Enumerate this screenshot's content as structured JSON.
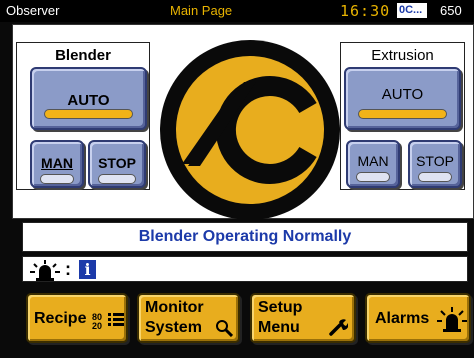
{
  "topbar": {
    "user": "Observer",
    "page_title": "Main Page",
    "clock": "16:30",
    "code": "0C...",
    "number": "650"
  },
  "blender": {
    "title": "Blender",
    "auto_label": "AUTO",
    "man_label": "MAN",
    "stop_label": "STOP",
    "active_mode": "auto"
  },
  "extrusion": {
    "title": "Extrusion",
    "auto_label": "AUTO",
    "man_label": "MAN",
    "stop_label": "STOP",
    "active_mode": "auto"
  },
  "status": {
    "message": "Blender Operating Normally"
  },
  "alarm_line": {
    "separator": ":",
    "info_glyph": "i"
  },
  "nav": {
    "recipe": "Recipe",
    "recipe_ratio_top": "80",
    "recipe_ratio_bottom": "20",
    "monitor_line1": "Monitor",
    "monitor_line2": "System",
    "setup_line1": "Setup",
    "setup_line2": "Menu",
    "alarms": "Alarms"
  },
  "colors": {
    "accent_gold": "#e8ad1e",
    "button_blue": "#8b9bc8",
    "status_text_blue": "#1c3aa9"
  },
  "icons": [
    "alarm-beacon-icon",
    "info-icon",
    "list-icon",
    "magnifier-icon",
    "wrench-icon",
    "alarm-light-icon"
  ]
}
